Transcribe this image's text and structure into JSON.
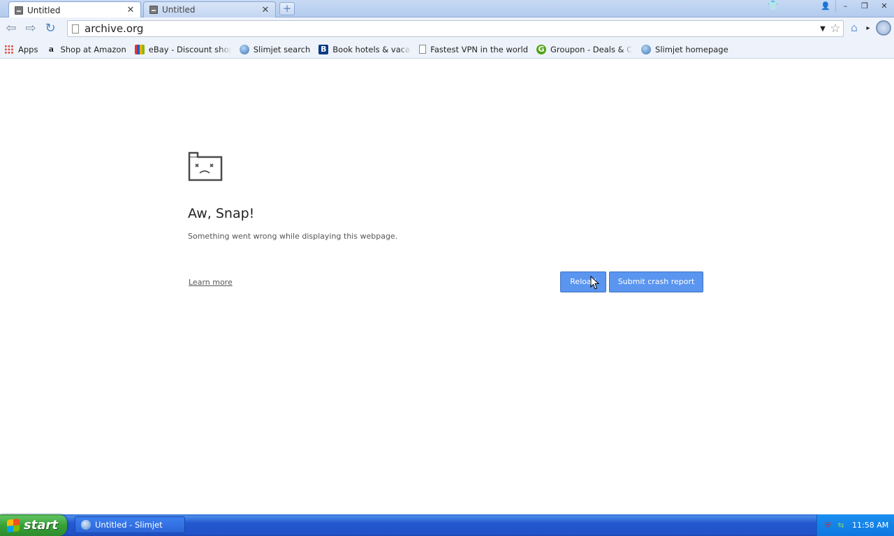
{
  "tabs": [
    {
      "title": "Untitled",
      "active": true
    },
    {
      "title": "Untitled",
      "active": false
    }
  ],
  "new_tab_symbol": "+",
  "window_controls": {
    "minimize": "–",
    "maximize": "❐",
    "close": "✕"
  },
  "address_bar": {
    "url": "archive.org"
  },
  "bookmarks": [
    {
      "label": "Apps",
      "icon": "apps-grid-icon"
    },
    {
      "label": "Shop at Amazon",
      "icon": "amazon-icon"
    },
    {
      "label": "eBay - Discount shoppin",
      "icon": "ebay-icon"
    },
    {
      "label": "Slimjet search",
      "icon": "globe-icon"
    },
    {
      "label": "Book hotels & vacation r",
      "icon": "booking-icon"
    },
    {
      "label": "Fastest VPN in the world",
      "icon": "page-icon"
    },
    {
      "label": "Groupon - Deals & Coup",
      "icon": "groupon-icon"
    },
    {
      "label": "Slimjet homepage",
      "icon": "globe-icon"
    }
  ],
  "crash_page": {
    "heading": "Aw, Snap!",
    "message": "Something went wrong while displaying this webpage.",
    "learn_more": "Learn more",
    "reload_button": "Reload",
    "report_button": "Submit crash report"
  },
  "taskbar": {
    "start_label": "start",
    "task_label": "Untitled - Slimjet",
    "clock": "11:58 AM"
  },
  "colors": {
    "button_blue": "#5a95f0",
    "taskbar_blue": "#2458d0",
    "start_green": "#37a237"
  }
}
